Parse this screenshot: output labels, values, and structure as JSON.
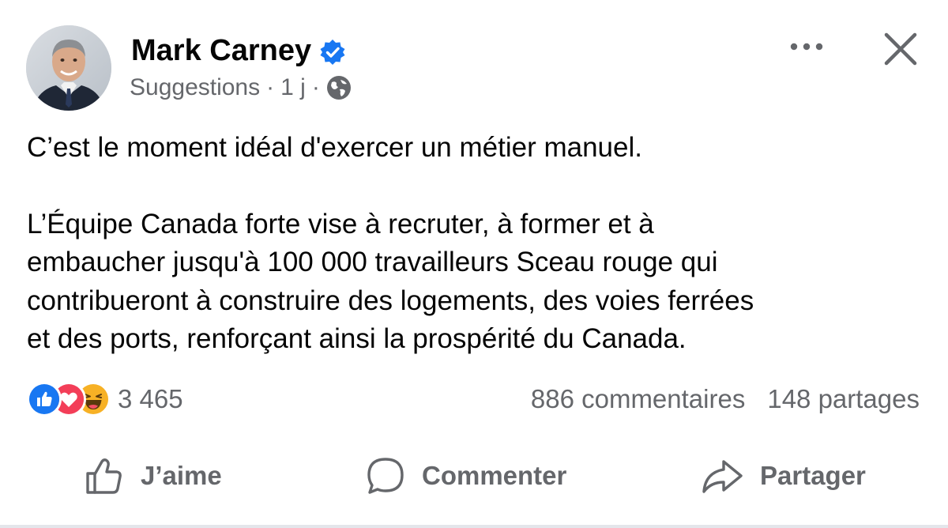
{
  "post": {
    "author": "Mark Carney",
    "meta_source": "Suggestions",
    "meta_dot": "·",
    "meta_time": "1 j",
    "paragraph1": "C’est le moment idéal d'exercer un métier manuel.",
    "paragraph2_lines": [
      "L’Équipe Canada forte vise à recruter, à former et à",
      "embaucher jusqu'à 100 000 travailleurs Sceau rouge qui",
      "contribueront à construire des logements, des voies ferrées",
      "et des  ports, renforçant ainsi la prospérité du Canada."
    ]
  },
  "reactions": {
    "count": "3 465",
    "icons": [
      "like-reaction-icon",
      "love-reaction-icon",
      "haha-reaction-icon"
    ]
  },
  "stats": {
    "comments": "886 commentaires",
    "shares": "148 partages"
  },
  "actions": {
    "like": "J’aime",
    "comment": "Commenter",
    "share": "Partager"
  },
  "colors": {
    "secondary_text": "#65676b",
    "verified_blue": "#1877f2",
    "like_blue": "#1877f2",
    "love_red": "#f33e58",
    "haha_yellow": "#f7b125"
  }
}
